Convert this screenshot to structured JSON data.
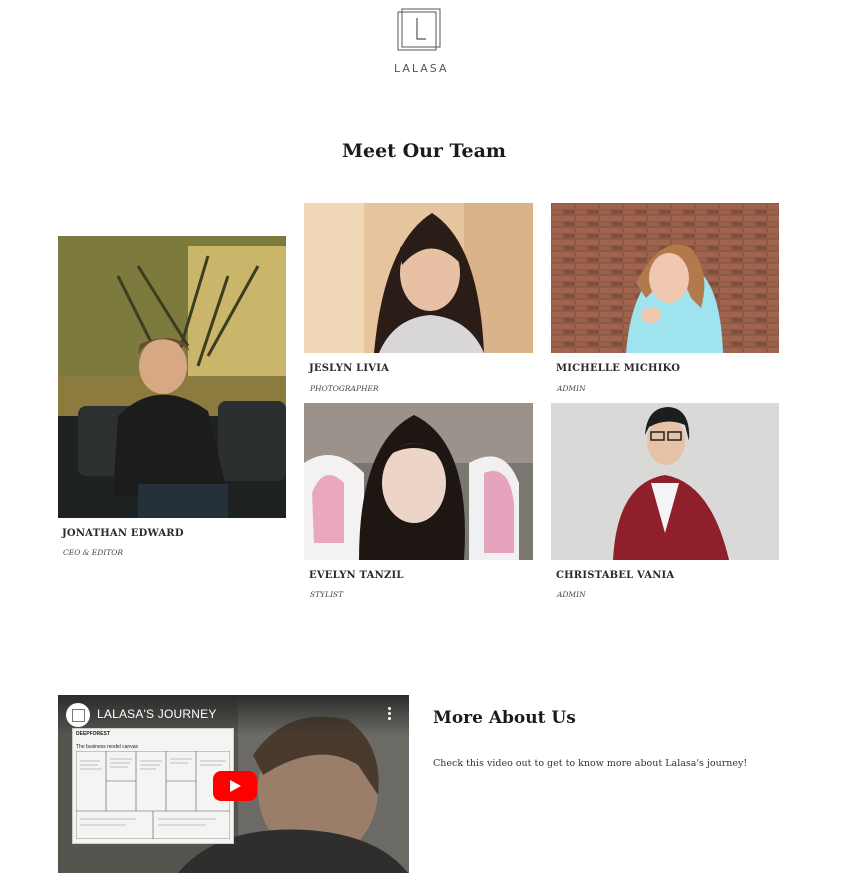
{
  "brand": {
    "logo_text": "LALASA"
  },
  "team": {
    "title": "Meet Our Team",
    "members": [
      {
        "name": "JONATHAN EDWARD",
        "role": "CEO & EDITOR"
      },
      {
        "name": "JESLYN LIVIA",
        "role": "PHOTOGRAPHER"
      },
      {
        "name": "MICHELLE MICHIKO",
        "role": "ADMIN"
      },
      {
        "name": "EVELYN TANZIL",
        "role": "STYLIST"
      },
      {
        "name": "CHRISTABEL VANIA",
        "role": "ADMIN"
      }
    ]
  },
  "video": {
    "title": "LALASA'S JOURNEY",
    "doc_heading": "DEEPFOREST",
    "doc_subheading": "The business model canvas"
  },
  "about": {
    "title": "More About Us",
    "text": "Check this video out to get to know more about Lalasa's journey!"
  },
  "icons": {
    "logo": "square-logo-icon",
    "channel": "channel-avatar-icon",
    "more": "more-vert-icon",
    "play": "youtube-play-icon"
  }
}
